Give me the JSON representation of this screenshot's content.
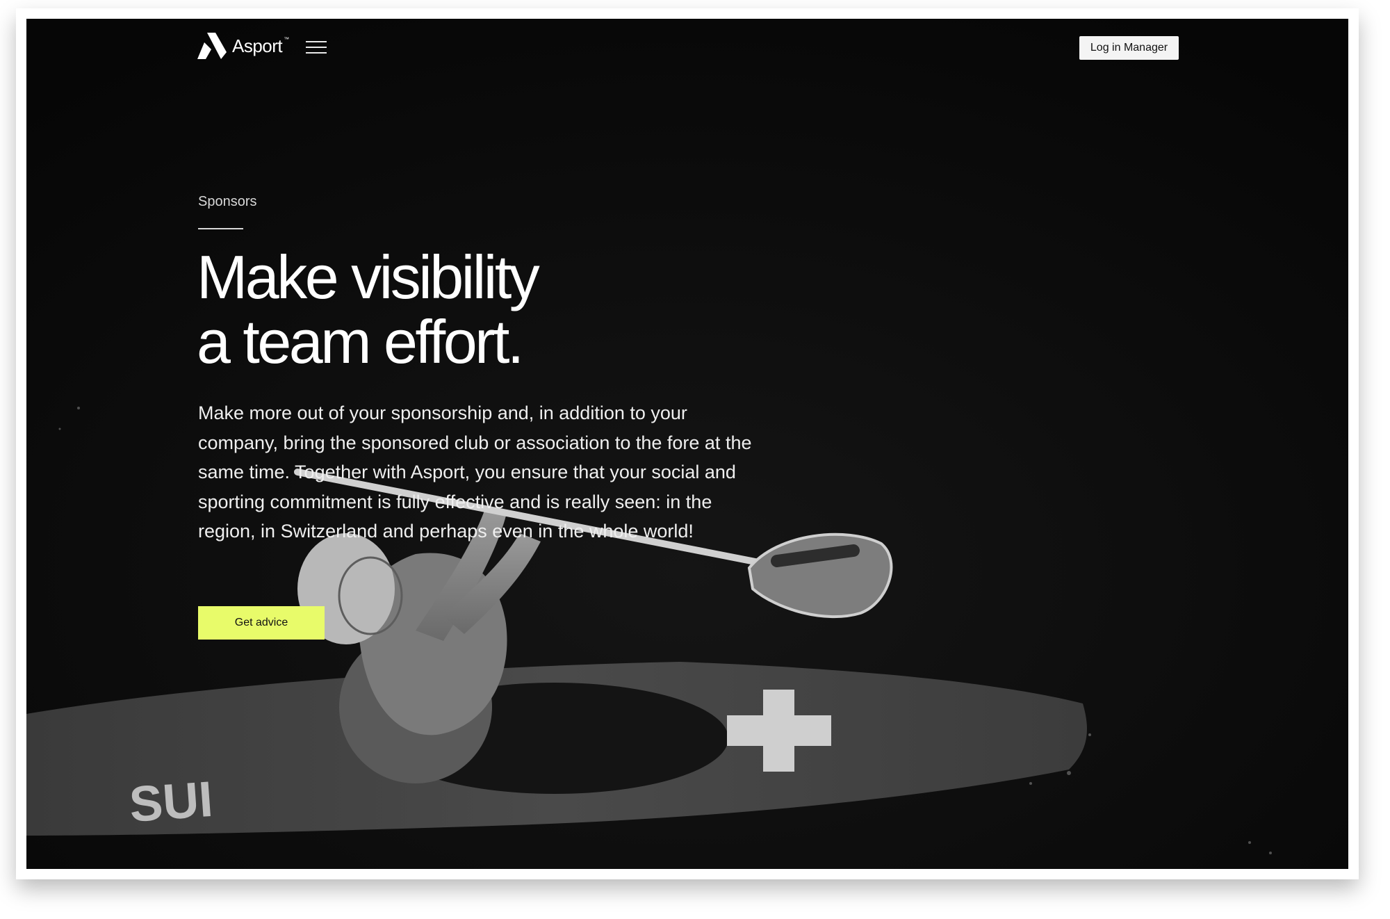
{
  "header": {
    "brand": "Asport",
    "brand_tm": "™",
    "login_label": "Log in Manager"
  },
  "hero": {
    "eyebrow": "Sponsors",
    "title_line1": "Make visibility",
    "title_line2": "a team effort.",
    "body": "Make more out of your sponsorship and, in addition to your company, bring the sponsored club or association to the fore at the same time. Together with Asport, you ensure that your social and sporting commitment is fully effective and is really seen: in the region, in Switzerland and perhaps even in the whole world!",
    "cta_label": "Get advice"
  },
  "colors": {
    "accent": "#e8fb6a",
    "background": "#0b0b0b",
    "text": "#ffffff"
  },
  "icons": [
    "asport-logo-icon",
    "hamburger-menu-icon"
  ]
}
